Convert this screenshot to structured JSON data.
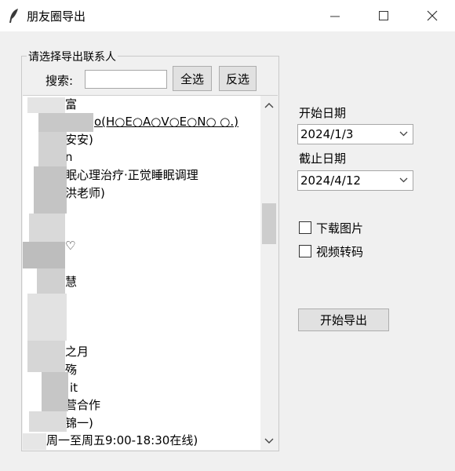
{
  "window": {
    "title": "朋友圈导出",
    "controls": [
      "minimize",
      "maximize",
      "close"
    ]
  },
  "contacts_group": {
    "legend": "请选择导出联系人",
    "search_label": "搜索:",
    "search_value": "",
    "select_all_label": "全选",
    "invert_label": "反选",
    "items": [
      "富",
      "o(H○E○A○V○E○N○ ○.)",
      "安安)",
      "n",
      "眠心理治疗·正觉睡眠调理",
      "洪老师)",
      "",
      "",
      "♡",
      "",
      "慧",
      "",
      "",
      "",
      "之月",
      "殇",
      "it",
      "营合作",
      "锦一)",
      "周一至周五9:00-18:30在线)"
    ]
  },
  "options": {
    "start_date_label": "开始日期",
    "start_date_value": "2024/1/3",
    "end_date_label": "截止日期",
    "end_date_value": "2024/4/12",
    "download_images_label": "下载图片",
    "download_images_checked": false,
    "video_transcode_label": "视频转码",
    "video_transcode_checked": false,
    "export_button_label": "开始导出"
  },
  "icons": {
    "app": "feather-icon",
    "minimize": "minimize-icon",
    "maximize": "maximize-icon",
    "close": "close-icon",
    "scroll_up": "chevron-up-icon",
    "scroll_down": "chevron-down-icon",
    "dropdown": "chevron-down-icon"
  }
}
